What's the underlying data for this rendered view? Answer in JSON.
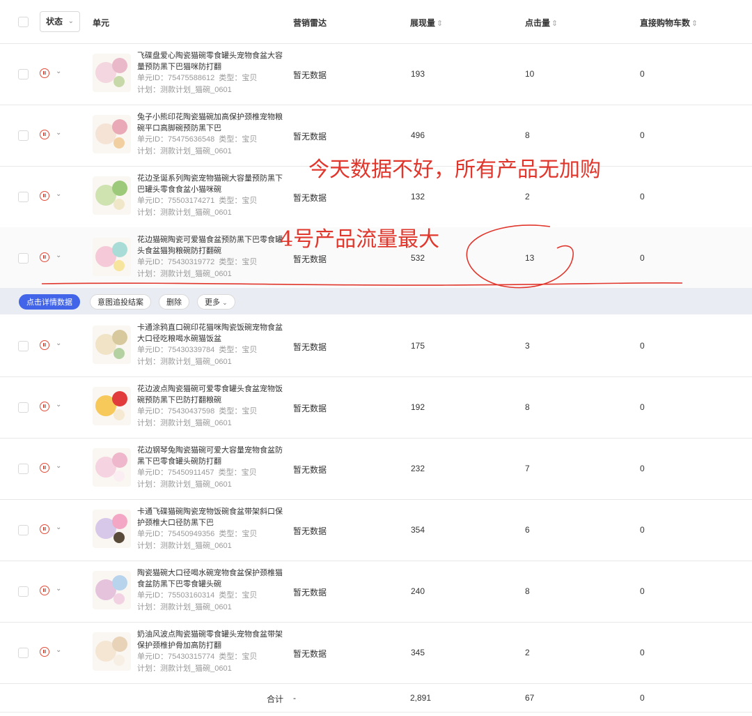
{
  "header": {
    "status_label": "状态",
    "unit": "单元",
    "radar": "营销雷达",
    "impressions": "展现量",
    "clicks": "点击量",
    "cart": "直接购物车数"
  },
  "meta_labels": {
    "unit_id_prefix": "单元ID：",
    "type_prefix": "类型：",
    "plan_prefix": "计划："
  },
  "rows": [
    {
      "title": "飞碟盘爱心陶瓷猫碗零食罐头宠物食盆大容量预防黑下巴猫咪防打翻",
      "unit_id": "75475588612",
      "type": "宝贝",
      "plan": "测款计划_猫碗_0601",
      "radar": "暂无数据",
      "impressions": "193",
      "clicks": "10",
      "cart": "0",
      "thumb_colors": [
        "#f3d6df",
        "#e9b9c9",
        "#c7d9a8"
      ]
    },
    {
      "title": "兔子小熊印花陶瓷猫碗加高保护颈椎宠物粮碗平口高脚碗预防黑下巴",
      "unit_id": "75475636548",
      "type": "宝贝",
      "plan": "测款计划_猫碗_0601",
      "radar": "暂无数据",
      "impressions": "496",
      "clicks": "8",
      "cart": "0",
      "thumb_colors": [
        "#f5e3d6",
        "#e9a9b6",
        "#f2cfa0"
      ]
    },
    {
      "title": "花边圣诞系列陶瓷宠物猫碗大容量预防黑下巴罐头零食食盆小猫咪碗",
      "unit_id": "75503174271",
      "type": "宝贝",
      "plan": "测款计划_猫碗_0601",
      "radar": "暂无数据",
      "impressions": "132",
      "clicks": "2",
      "cart": "0",
      "thumb_colors": [
        "#cfe3b0",
        "#9cc97a",
        "#f0e6c8"
      ]
    },
    {
      "title": "花边猫碗陶瓷可爱猫食盆预防黑下巴零食罐头食盆猫狗粮碗防打翻碗",
      "unit_id": "75430319772",
      "type": "宝贝",
      "plan": "测款计划_猫碗_0601",
      "radar": "暂无数据",
      "impressions": "532",
      "clicks": "13",
      "cart": "0",
      "thumb_colors": [
        "#f6c9d8",
        "#a9dcd6",
        "#f7e49d"
      ]
    },
    {
      "title": "卡通涂鸦直口碗印花猫咪陶瓷饭碗宠物食盆大口径吃粮喝水碗猫饭盆",
      "unit_id": "75430339784",
      "type": "宝贝",
      "plan": "测款计划_猫碗_0601",
      "radar": "暂无数据",
      "impressions": "175",
      "clicks": "3",
      "cart": "0",
      "thumb_colors": [
        "#f0e3c6",
        "#d8c89d",
        "#b4d2a1"
      ]
    },
    {
      "title": "花边波点陶瓷猫碗可爱零食罐头食盆宠物饭碗预防黑下巴防打翻粮碗",
      "unit_id": "75430437598",
      "type": "宝贝",
      "plan": "测款计划_猫碗_0601",
      "radar": "暂无数据",
      "impressions": "192",
      "clicks": "8",
      "cart": "0",
      "thumb_colors": [
        "#f7c85a",
        "#e23b3b",
        "#f5e9d2"
      ]
    },
    {
      "title": "花边钢琴兔陶瓷猫碗可爱大容量宠物食盆防黑下巴零食罐头碗防打翻",
      "unit_id": "75450911457",
      "type": "宝贝",
      "plan": "测款计划_猫碗_0601",
      "radar": "暂无数据",
      "impressions": "232",
      "clicks": "7",
      "cart": "0",
      "thumb_colors": [
        "#f6d3e0",
        "#eeb7cb",
        "#fbeef2"
      ]
    },
    {
      "title": "卡通飞碟猫碗陶瓷宠物饭碗食盆带架斜口保护颈椎大口径防黑下巴",
      "unit_id": "75450949356",
      "type": "宝贝",
      "plan": "测款计划_猫碗_0601",
      "radar": "暂无数据",
      "impressions": "354",
      "clicks": "6",
      "cart": "0",
      "thumb_colors": [
        "#d7c7e9",
        "#f3a7c4",
        "#5a4a3a"
      ]
    },
    {
      "title": "陶瓷猫碗大口径喝水碗宠物食盆保护颈椎猫食盆防黑下巴零食罐头碗",
      "unit_id": "75503160314",
      "type": "宝贝",
      "plan": "测款计划_猫碗_0601",
      "radar": "暂无数据",
      "impressions": "240",
      "clicks": "8",
      "cart": "0",
      "thumb_colors": [
        "#e6c3dc",
        "#b8d4ec",
        "#f2d1e2"
      ]
    },
    {
      "title": "奶油风波点陶瓷猫碗零食罐头宠物食盆带架保护颈椎护骨加高防打翻",
      "unit_id": "75430315774",
      "type": "宝贝",
      "plan": "测款计划_猫碗_0601",
      "radar": "暂无数据",
      "impressions": "345",
      "clicks": "2",
      "cart": "0",
      "thumb_colors": [
        "#f4e6d2",
        "#e8d2b8",
        "#f7efe4"
      ]
    }
  ],
  "actionbar": {
    "detail": "点击详情数据",
    "intent": "意图追投结案",
    "delete": "删除",
    "more": "更多"
  },
  "total": {
    "label": "合计",
    "radar": "-",
    "impressions": "2,891",
    "clicks": "67",
    "cart": "0"
  },
  "annotations": {
    "note1": "今天数据不好，所有产品无加购",
    "note2": "4号产品流量最大"
  },
  "colors": {
    "accent": "#4164e8",
    "status_paused": "#e34a3a",
    "annotation": "#e0362c"
  }
}
